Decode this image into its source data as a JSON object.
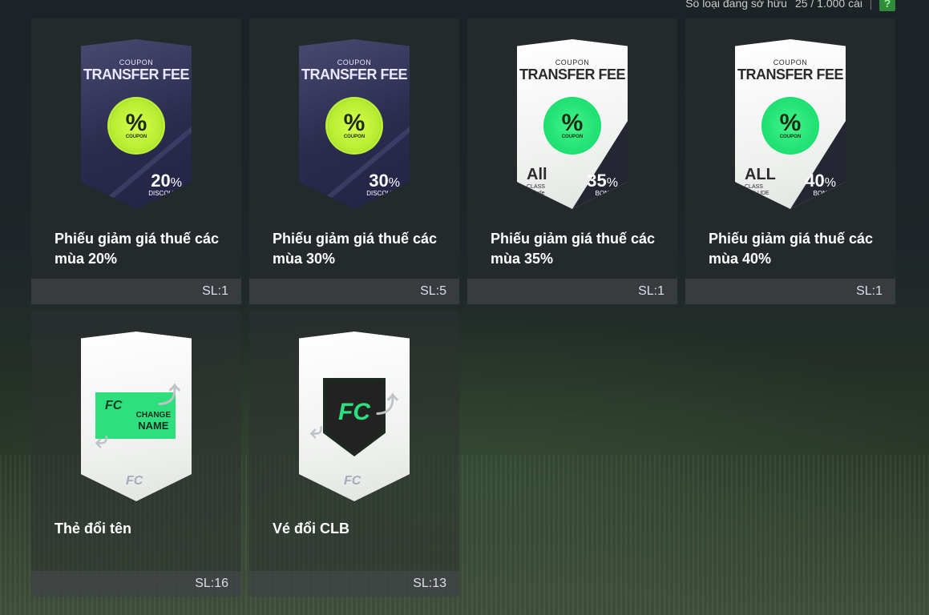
{
  "header": {
    "owned_label": "Số loại đang sở hữu",
    "owned_count": "25 / 1.000 cái",
    "help_label": "?"
  },
  "items": [
    {
      "name": "Phiếu giảm giá thuế các mùa 20%",
      "qty": "SL:1",
      "card_title_small": "COUPON",
      "card_title": "TRANSFER FEE",
      "value": "20",
      "value_unit": "%",
      "value_label": "DISCOUNT"
    },
    {
      "name": "Phiếu giảm giá thuế các mùa 30%",
      "qty": "SL:5",
      "card_title_small": "COUPON",
      "card_title": "TRANSFER FEE",
      "value": "30",
      "value_unit": "%",
      "value_label": "DISCOUNT"
    },
    {
      "name": "Phiếu giảm giá thuế các mùa 35%",
      "qty": "SL:1",
      "card_title_small": "COUPON",
      "card_title": "TRANSFER FEE",
      "value": "35",
      "value_unit": "%",
      "value_label": "BONUS",
      "class_big": "All",
      "class_small1": "CLASS",
      "class_small2": "Include"
    },
    {
      "name": "Phiếu giảm giá thuế các mùa 40%",
      "qty": "SL:1",
      "card_title_small": "COUPON",
      "card_title": "TRANSFER FEE",
      "value": "40",
      "value_unit": "%",
      "value_label": "BONUS",
      "class_big": "ALL",
      "class_small1": "CLASS",
      "class_small2": "INCLUDE"
    },
    {
      "name": "Thẻ đổi tên",
      "qty": "SL:16",
      "ticket_line1": "CHANGE",
      "ticket_line2": "NAME"
    },
    {
      "name": "Vé đổi CLB",
      "qty": "SL:13"
    }
  ],
  "badge": {
    "symbol": "%",
    "label": "COUPON"
  },
  "brand_mark": "FC",
  "colors": {
    "accent_green": "#2de07d",
    "lime": "#b9f03a",
    "dark_card": "#2b2b4e"
  }
}
